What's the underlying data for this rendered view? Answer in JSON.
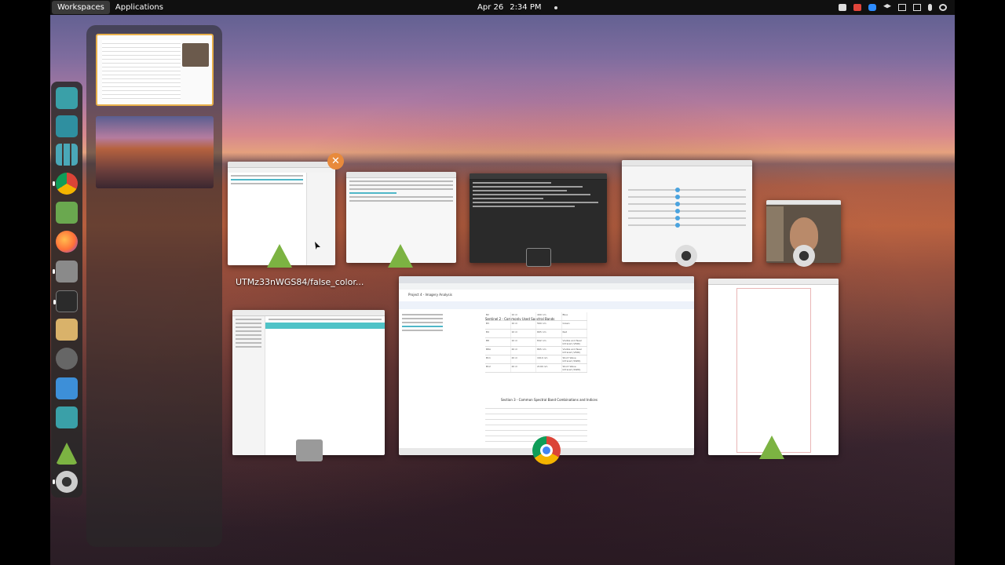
{
  "panel": {
    "workspaces_label": "Workspaces",
    "applications_label": "Applications",
    "date": "Apr 26",
    "time": "2:34 PM"
  },
  "dash": {
    "items": [
      {
        "name": "image-search-icon",
        "color": "#3aa0a8"
      },
      {
        "name": "window-layout-icon",
        "color": "#2f8fa0"
      },
      {
        "name": "app-grid-icon",
        "color": "#4aa8b8"
      },
      {
        "name": "chrome-icon",
        "color": "#db4437"
      },
      {
        "name": "calculator-icon",
        "color": "#6aa84f"
      },
      {
        "name": "firefox-icon",
        "color": "#ff7139"
      },
      {
        "name": "files-icon",
        "color": "#8a8a8a"
      },
      {
        "name": "terminal-icon",
        "color": "#2b2b2b"
      },
      {
        "name": "text-editor-icon",
        "color": "#d9b26a"
      },
      {
        "name": "settings-icon",
        "color": "#666666"
      },
      {
        "name": "screenshot-icon",
        "color": "#3d8fd8"
      },
      {
        "name": "image-viewer-icon",
        "color": "#3aa0a8"
      },
      {
        "name": "qgis-icon",
        "color": "#7cb342"
      },
      {
        "name": "webcam-icon",
        "color": "#cccccc"
      }
    ]
  },
  "windows": {
    "qgis_caption": "UTMz33nWGS84/false_color...",
    "chrome_tab_title": "Project 4 - Imagery Analysis",
    "chrome_doc": {
      "section_title": "Sentinel 2 - Commonly Used Spectral Bands",
      "section2_title": "Section 3 - Common Spectral Band Combinations and Indices",
      "bands": [
        [
          "B2",
          "10 m",
          "490 nm",
          "Blue"
        ],
        [
          "B3",
          "10 m",
          "560 nm",
          "Green"
        ],
        [
          "B4",
          "10 m",
          "665 nm",
          "Red"
        ],
        [
          "B8",
          "10 m",
          "842 nm",
          "Visible and Near Infrared (VNIR)"
        ],
        [
          "B8A",
          "20 m",
          "865 nm",
          "Visible and Near Infrared (VNIR)"
        ],
        [
          "B11",
          "20 m",
          "1610 nm",
          "Short Wave Infrared (SWIR)"
        ],
        [
          "B12",
          "20 m",
          "2190 nm",
          "Short Wave Infrared (SWIR)"
        ]
      ]
    }
  }
}
